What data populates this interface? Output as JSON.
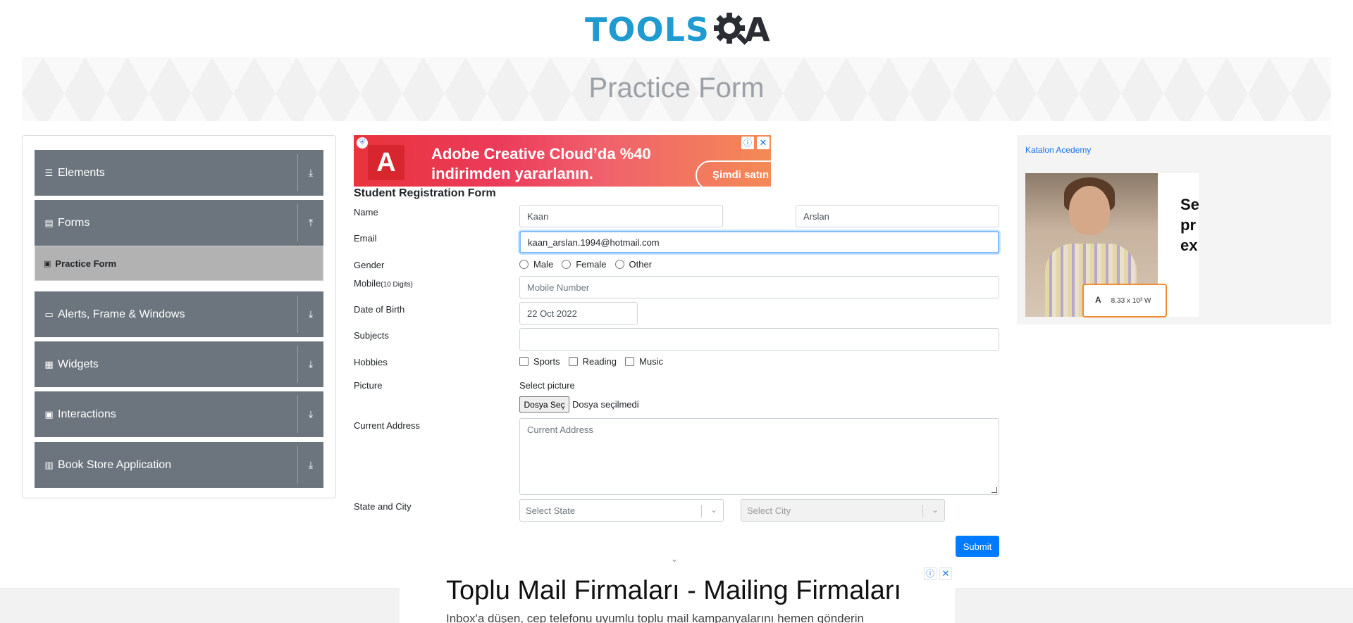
{
  "header": {
    "logo_tools": "TOOLS",
    "logo_a": "A"
  },
  "banner": {
    "title": "Practice Form"
  },
  "sidebar": {
    "groups": [
      {
        "label": "Elements",
        "icon": "menu-icon",
        "arrow": "download-arrow-icon"
      },
      {
        "label": "Forms",
        "icon": "form-icon",
        "arrow": "upload-arrow-icon"
      },
      {
        "label": "Alerts, Frame & Windows",
        "icon": "window-icon",
        "arrow": "download-arrow-icon"
      },
      {
        "label": "Widgets",
        "icon": "grid-icon",
        "arrow": "download-arrow-icon"
      },
      {
        "label": "Interactions",
        "icon": "interaction-icon",
        "arrow": "download-arrow-icon"
      },
      {
        "label": "Book Store Application",
        "icon": "books-icon",
        "arrow": "download-arrow-icon"
      }
    ],
    "subitem": {
      "label": "Practice Form"
    }
  },
  "top_ad": {
    "line1": "Adobe Creative Cloud’da %40",
    "line2": "indirimden yararlanın.",
    "button": "Şimdi satın"
  },
  "form": {
    "title": "Student Registration Form",
    "labels": {
      "name": "Name",
      "email": "Email",
      "gender": "Gender",
      "mobile": "Mobile",
      "mobile_hint": "(10 Digits)",
      "dob": "Date of Birth",
      "subjects": "Subjects",
      "hobbies": "Hobbies",
      "picture": "Picture",
      "address": "Current Address",
      "state_city": "State and City"
    },
    "first_name": "Kaan",
    "last_name": "Arslan",
    "email": "kaan_arslan.1994@hotmail.com",
    "genders": [
      "Male",
      "Female",
      "Other"
    ],
    "mobile_placeholder": "Mobile Number",
    "dob": "22 Oct 2022",
    "subjects": "",
    "hobbies": [
      "Sports",
      "Reading",
      "Music"
    ],
    "picture_label": "Select picture",
    "file_button": "Dosya Seç",
    "file_status": "Dosya seçilmedi",
    "address_placeholder": "Current Address",
    "state_placeholder": "Select State",
    "city_placeholder": "Select City",
    "submit": "Submit"
  },
  "right_ad": {
    "alt": "Katalon Acedemy",
    "text_lines": [
      "Se",
      "pr",
      "ex"
    ],
    "card_letter": "A",
    "card_value": "8.33 x 10³ W"
  },
  "bottom_ad": {
    "title": "Toplu Mail Firmaları - Mailing Firmaları",
    "subtitle": "Inbox'a düşen, cep telefonu uyumlu toplu mail kampanyalarını hemen gönderin"
  }
}
